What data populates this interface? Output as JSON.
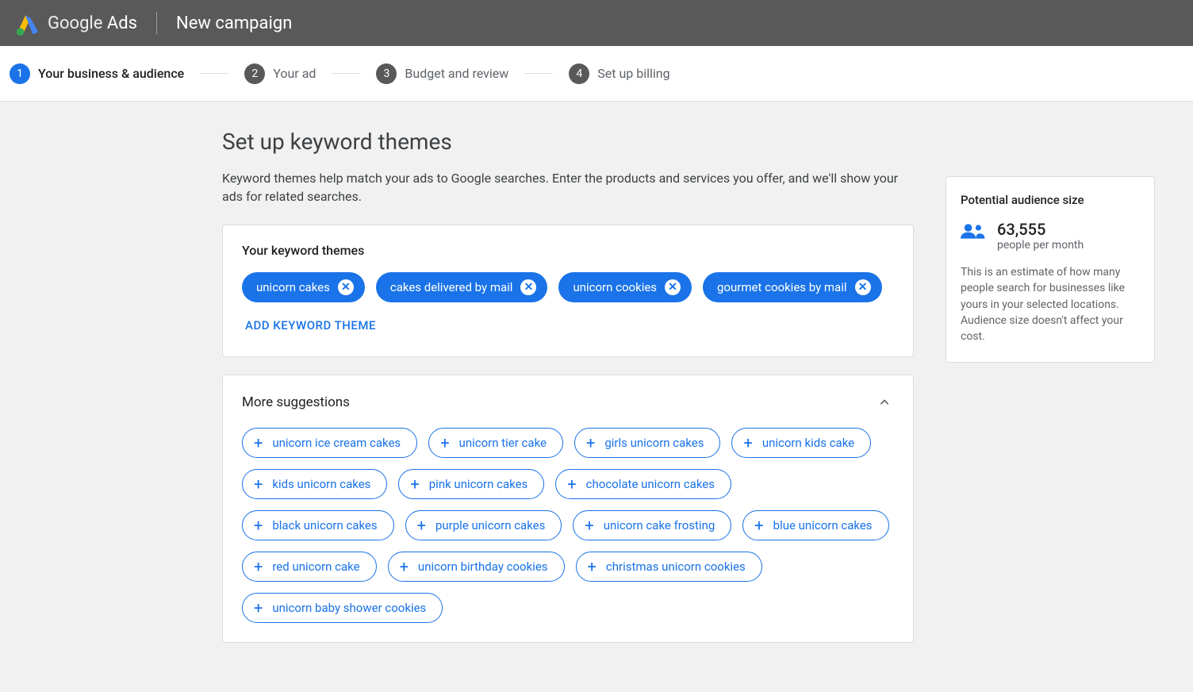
{
  "header": {
    "brand_a": "Google",
    "brand_b": "Ads",
    "page_title": "New campaign"
  },
  "stepper": {
    "items": [
      {
        "num": "1",
        "label": "Your business & audience",
        "active": true
      },
      {
        "num": "2",
        "label": "Your ad"
      },
      {
        "num": "3",
        "label": "Budget and review"
      },
      {
        "num": "4",
        "label": "Set up billing"
      }
    ]
  },
  "page": {
    "heading": "Set up keyword themes",
    "subheading": "Keyword themes help match your ads to Google searches. Enter the products and services you offer, and we'll show your ads for related searches."
  },
  "themes_card": {
    "title": "Your keyword themes",
    "chips": [
      "unicorn cakes",
      "cakes delivered by mail",
      "unicorn cookies",
      "gourmet cookies by mail"
    ],
    "add_label": "ADD KEYWORD THEME"
  },
  "suggestions_card": {
    "title": "More suggestions",
    "chips": [
      "unicorn ice cream cakes",
      "unicorn tier cake",
      "girls unicorn cakes",
      "unicorn kids cake",
      "kids unicorn cakes",
      "pink unicorn cakes",
      "chocolate unicorn cakes",
      "black unicorn cakes",
      "purple unicorn cakes",
      "unicorn cake frosting",
      "blue unicorn cakes",
      "red unicorn cake",
      "unicorn birthday cookies",
      "christmas unicorn cookies",
      "unicorn baby shower cookies"
    ]
  },
  "audience_panel": {
    "title": "Potential audience size",
    "value": "63,555",
    "unit": "people per month",
    "description": "This is an estimate of how many people search for businesses like yours in your selected locations. Audience size doesn't affect your cost."
  }
}
